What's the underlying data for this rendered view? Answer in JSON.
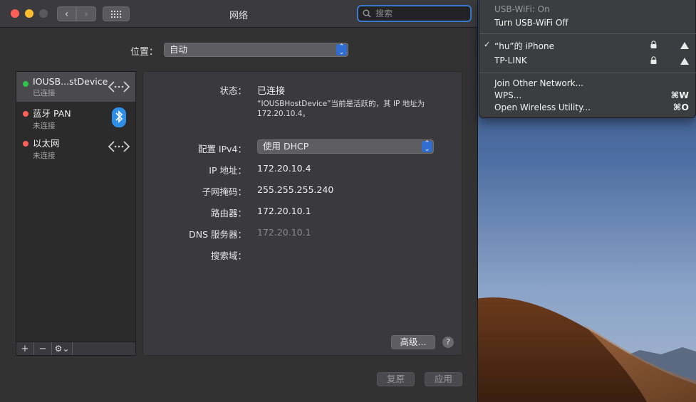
{
  "window": {
    "title": "网络",
    "search_placeholder": "搜索"
  },
  "location": {
    "label": "位置：",
    "value": "自动"
  },
  "services": [
    {
      "name": "IOUSB...stDevice",
      "status": "已连接",
      "status_color": "#2ec54b",
      "icon": "network-arrows-icon"
    },
    {
      "name": "蓝牙 PAN",
      "status": "未连接",
      "status_color": "#fe5f57",
      "icon": "bluetooth-icon"
    },
    {
      "name": "以太网",
      "status": "未连接",
      "status_color": "#fe5f57",
      "icon": "network-arrows-icon"
    }
  ],
  "service_bar": {
    "add": "+",
    "remove": "−",
    "gear": "⚙⌄"
  },
  "detail": {
    "status_label": "状态：",
    "status_value": "已连接",
    "description": "“IOUSBHostDevice”当前是活跃的，其 IP 地址为 172.20.10.4。",
    "ipv4_label": "配置 IPv4：",
    "ipv4_value": "使用 DHCP",
    "ip_label": "IP 地址：",
    "ip_value": "172.20.10.4",
    "subnet_label": "子网掩码：",
    "subnet_value": "255.255.255.240",
    "router_label": "路由器：",
    "router_value": "172.20.10.1",
    "dns_label": "DNS 服务器：",
    "dns_value": "172.20.10.1",
    "search_domain_label": "搜索域：",
    "advanced_button": "高级...",
    "help": "?"
  },
  "footer": {
    "revert_button": "复原",
    "apply_button": "应用"
  },
  "wifi_menu": {
    "status": "USB-WiFi: On",
    "turn_off": "Turn USB-WiFi Off",
    "networks": [
      {
        "name": "“hu”的 iPhone",
        "checked": true
      },
      {
        "name": "TP-LINK",
        "checked": false
      }
    ],
    "check_mark": "✓",
    "join_other": "Join Other Network...",
    "wps": "WPS...",
    "wps_shortcut": "⌘W",
    "open_utility": "Open Wireless Utility...",
    "open_utility_shortcut": "⌘O"
  },
  "colors": {
    "accent": "#2f6dd0",
    "connected": "#2ec54b",
    "disconnected": "#fe5f57"
  }
}
